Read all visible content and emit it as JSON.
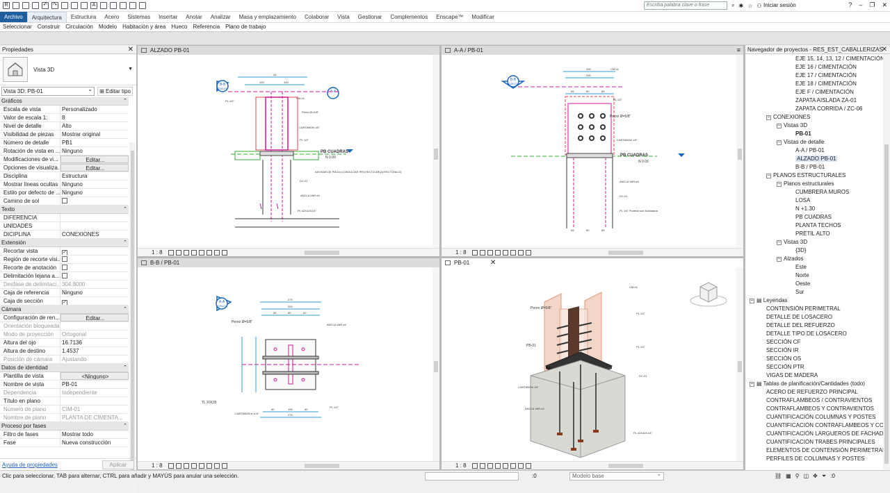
{
  "titlebar": {
    "search_placeholder": "Escriba palabra clave o frase",
    "login": "Iniciar sesión"
  },
  "menu": [
    "Archivo",
    "Arquitectura",
    "Estructura",
    "Acero",
    "Sistemas",
    "Insertar",
    "Anotar",
    "Analizar",
    "Masa y emplazamiento",
    "Colaborar",
    "Vista",
    "Gestionar",
    "Complementos",
    "Enscape™",
    "Modificar"
  ],
  "submenu": [
    "Seleccionar",
    "Construir",
    "Circulación",
    "Modelo",
    "Habitación y área",
    "Hueco",
    "Referencia",
    "Plano de trabajo"
  ],
  "properties": {
    "title": "Propiedades",
    "type_name": "Vista 3D",
    "selector": "Vista 3D: PB-01",
    "edit_type": "Editar tipo",
    "groups": [
      {
        "name": "Gráficos",
        "rows": [
          {
            "k": "Escala de vista",
            "v": "Personalizado"
          },
          {
            "k": "Valor de escala    1:",
            "v": "8"
          },
          {
            "k": "Nivel de detalle",
            "v": "Alto"
          },
          {
            "k": "Visibilidad de piezas",
            "v": "Mostrar original"
          },
          {
            "k": "Número de detalle",
            "v": "PB1"
          },
          {
            "k": "Rotación de vista en ...",
            "v": "Ninguno"
          },
          {
            "k": "Modificaciones de vi...",
            "v": "Editar...",
            "btn": true
          },
          {
            "k": "Opciones de visualiza...",
            "v": "Editar...",
            "btn": true
          },
          {
            "k": "Disciplina",
            "v": "Estructura"
          },
          {
            "k": "Mostrar líneas ocultas",
            "v": "Ninguno"
          },
          {
            "k": "Estilo por defecto de ...",
            "v": "Ninguno"
          },
          {
            "k": "Camino de sol",
            "v": "",
            "check": false
          }
        ]
      },
      {
        "name": "Texto",
        "rows": [
          {
            "k": "DIFERENCIA",
            "v": ""
          },
          {
            "k": "UNIDADES",
            "v": ""
          },
          {
            "k": "DICIPLINA",
            "v": "CONEXIONES"
          }
        ]
      },
      {
        "name": "Extensión",
        "rows": [
          {
            "k": "Recortar vista",
            "v": "",
            "check": true
          },
          {
            "k": "Región de recorte visi...",
            "v": "",
            "check": false
          },
          {
            "k": "Recorte de anotación",
            "v": "",
            "check": false
          },
          {
            "k": "Delimitación lejana a...",
            "v": "",
            "check": false
          },
          {
            "k": "Desfase de delimitaci...",
            "v": "304.8000",
            "dis": true
          },
          {
            "k": "Caja de referencia",
            "v": "Ninguno"
          },
          {
            "k": "Caja de sección",
            "v": "",
            "check": true
          }
        ]
      },
      {
        "name": "Cámara",
        "rows": [
          {
            "k": "Configuración de ren...",
            "v": "Editar...",
            "btn": true
          },
          {
            "k": "Orientación bloqueada",
            "v": "",
            "dis": true
          },
          {
            "k": "Modo de proyección",
            "v": "Ortogonal",
            "dis": true
          },
          {
            "k": "Altura del ojo",
            "v": "16.7136"
          },
          {
            "k": "Altura de destino",
            "v": "1.4537"
          },
          {
            "k": "Posición de cámara",
            "v": "Ajustando",
            "dis": true
          }
        ]
      },
      {
        "name": "Datos de identidad",
        "rows": [
          {
            "k": "Plantilla de vista",
            "v": "<Ninguno>",
            "btn": true
          },
          {
            "k": "Nombre de vista",
            "v": "PB-01"
          },
          {
            "k": "Dependencia",
            "v": "Independiente",
            "dis": true
          },
          {
            "k": "Título en plano",
            "v": ""
          },
          {
            "k": "Número de plano",
            "v": "CIM-01",
            "dis": true
          },
          {
            "k": "Nombre de plano",
            "v": "PLANTA DE CIMENTA...",
            "dis": true
          }
        ]
      },
      {
        "name": "Proceso por fases",
        "rows": [
          {
            "k": "Filtro de fases",
            "v": "Mostrar todo"
          },
          {
            "k": "Fase",
            "v": "Nueva construcción"
          }
        ]
      }
    ],
    "help_link": "Ayuda de propiedades",
    "apply": "Aplicar"
  },
  "viewports": [
    {
      "tab": "ALZADO PB-01",
      "scale": "1 : 8"
    },
    {
      "tab": "A-A / PB-01",
      "scale": "1 : 8"
    },
    {
      "tab": "B-B / PB-01",
      "scale": "1 : 8"
    },
    {
      "tab": "PB-01",
      "scale": "1 : 8"
    }
  ],
  "drawings": {
    "alzado": {
      "section_label": "B-B",
      "section_sheet": "CIM-01",
      "section_label_right": "A-A",
      "dims_top": [
        "43",
        "100",
        "100",
        "20"
      ],
      "perno": "Perno\nØ=5/8\"",
      "labels": [
        "CM-01",
        "PL 1/2\"",
        "CARTABON 1/4\"",
        "PL 1/2\"",
        "ADOSAR DE PIEZA (CONSULTAR PROYECTO ARQUITECTÓNICO)",
        "DC-01",
        "ANCLA VAR.#4",
        "PL 42X42X1/4\""
      ],
      "level_name": "PB CUADRAS",
      "level_value": "N 0.00"
    },
    "aa": {
      "dims_top": [
        "250",
        "200",
        "65",
        "80",
        "65"
      ],
      "labels": [
        "CM-01",
        "PL 1/2\"",
        "Perno Ø=5/8\"",
        "CARTABON 1/4\"",
        "ANCLA VAR.#4",
        "DC-01",
        "PL 1/4\" Puntear con Soldadura"
      ],
      "dims_bottom": [
        "65",
        "80",
        "65"
      ],
      "level_name": "PB CUADRAS",
      "level_value": "N 0.00",
      "section_label": "B-B",
      "section_sheet": "CIM-01"
    },
    "bb": {
      "dims_top": [
        "275",
        "200",
        "55",
        "85",
        "60"
      ],
      "labels": [
        "Perno Ø=5/8\"",
        "ANCLA VAR.#4",
        "TL 20X35",
        "CARTABON e=1/4\"",
        "PL 1/2\""
      ],
      "dims_bottom": [
        "40",
        "195",
        "40",
        "275"
      ],
      "section_label": "A-A",
      "section_sheet": "CIM-01"
    },
    "iso": {
      "labels": [
        "CM-01",
        "Perno Ø=5/8\"",
        "PB-01",
        "PL 1/2\"",
        "PL 1/2\"",
        "DC-01",
        "CARTABON 1/4\"",
        "ANCLA VAR.#4",
        "PL 42X42X1/4\""
      ]
    }
  },
  "browser": {
    "title": "Navegador de proyectos - RES_EST_CABALLERIZAS",
    "nodes": [
      {
        "label": "EJE 15, 14, 13, 12 / CIMENTACIÓN",
        "indent": 4
      },
      {
        "label": "EJE 16 / CIMENTACIÓN",
        "indent": 4
      },
      {
        "label": "EJE 17 / CIMENTACIÓN",
        "indent": 4
      },
      {
        "label": "EJE 18 / CIMENTACIÓN",
        "indent": 4
      },
      {
        "label": "EJE F / CIMENTACIÓN",
        "indent": 4
      },
      {
        "label": "ZAPATA AISLADA ZA-01",
        "indent": 4
      },
      {
        "label": "ZAPATA CORRIDA / ZC-06",
        "indent": 4
      },
      {
        "label": "CONEXIONES",
        "indent": 2,
        "tog": "−"
      },
      {
        "label": "Vistas 3D",
        "indent": 3,
        "tog": "−"
      },
      {
        "label": "PB-01",
        "indent": 4,
        "bold": true
      },
      {
        "label": "Vistas de detalle",
        "indent": 3,
        "tog": "−"
      },
      {
        "label": "A-A / PB-01",
        "indent": 4
      },
      {
        "label": "ALZADO PB-01",
        "indent": 4,
        "sel": true
      },
      {
        "label": "B-B / PB-01",
        "indent": 4
      },
      {
        "label": "PLANOS ESTRUCTURALES",
        "indent": 2,
        "tog": "−"
      },
      {
        "label": "Planos estructurales",
        "indent": 3,
        "tog": "−"
      },
      {
        "label": "CUMBRERA MUROS",
        "indent": 4
      },
      {
        "label": "LOSA",
        "indent": 4
      },
      {
        "label": "N +1.30",
        "indent": 4
      },
      {
        "label": "PB CUADRAS",
        "indent": 4
      },
      {
        "label": "PLANTA TECHOS",
        "indent": 4
      },
      {
        "label": "PRETIL ALTO",
        "indent": 4
      },
      {
        "label": "Vistas 3D",
        "indent": 3,
        "tog": "−"
      },
      {
        "label": "{3D}",
        "indent": 4
      },
      {
        "label": "Alzados",
        "indent": 3,
        "tog": "−"
      },
      {
        "label": "Este",
        "indent": 4
      },
      {
        "label": "Norte",
        "indent": 4
      },
      {
        "label": "Oeste",
        "indent": 4
      },
      {
        "label": "Sur",
        "indent": 4
      },
      {
        "label": "Leyendas",
        "indent": 0,
        "tog": "−",
        "icon": true
      },
      {
        "label": "CONTENSIÓN PERIMETRAL",
        "indent": 1
      },
      {
        "label": "DETALLE DE LOSACERO",
        "indent": 1
      },
      {
        "label": "DETALLE DEL REFUERZO",
        "indent": 1
      },
      {
        "label": "DETALLE TIPO DE LOSACERO",
        "indent": 1
      },
      {
        "label": "SECCIÓN CF",
        "indent": 1
      },
      {
        "label": "SECCIÓN IR",
        "indent": 1
      },
      {
        "label": "SECCIÓN OS",
        "indent": 1
      },
      {
        "label": "SECCIÓN PTR",
        "indent": 1
      },
      {
        "label": "VIGAS DE MADERA",
        "indent": 1
      },
      {
        "label": "Tablas de planificación/Cantidades (todo)",
        "indent": 0,
        "tog": "−",
        "icon": true
      },
      {
        "label": "ACERO DE REFUERZO PRINCIPAL",
        "indent": 1
      },
      {
        "label": "CONTRAFLAMBEOS / CONTRAVIENTOS",
        "indent": 1
      },
      {
        "label": "CONTRAFLAMBEOS Y CONTRAVIENTOS",
        "indent": 1
      },
      {
        "label": "CUANTIFICACIÓN COLUMNAS Y POSTES",
        "indent": 1
      },
      {
        "label": "CUANTIFICACIÓN CONTRAFLAMBEOS Y CONTI",
        "indent": 1
      },
      {
        "label": "CUANTIFICACIÓN LARGUEROS DE FACHADA",
        "indent": 1
      },
      {
        "label": "CUANTIFICACIÓN TRABES PRINCIPALES",
        "indent": 1
      },
      {
        "label": "ELEMENTOS DE CONTENSIÓN PERIMETRAL",
        "indent": 1
      },
      {
        "label": "PERFILES DE COLUMNAS Y POSTES",
        "indent": 1
      }
    ]
  },
  "status": {
    "message": "Clic para seleccionar, TAB para alternar, CTRL para añadir y MAYÚS para anular una selección.",
    "worksets": ":0",
    "model": "Modelo base",
    "filter": ":0"
  },
  "colors": {
    "file_tab": "#1e5e9e",
    "magenta": "#d0179a",
    "cyan": "#2d9fd9",
    "green": "#33aa33",
    "red_hatch": "#e04040",
    "steel": "#3a3a3a"
  }
}
